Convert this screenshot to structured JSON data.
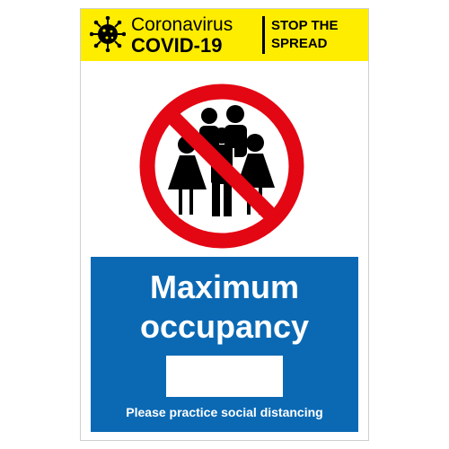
{
  "colors": {
    "header_bg": "#ffed00",
    "panel_bg": "#0b69b4",
    "prohibition_red": "#e30613",
    "figure_black": "#000000"
  },
  "header": {
    "brand_line1": "Coronavirus",
    "brand_line2": "COVID-19",
    "slogan_line1": "STOP THE",
    "slogan_line2": "SPREAD",
    "icon": "virus-icon"
  },
  "symbol": {
    "icon": "no-crowd-prohibition-icon"
  },
  "panel": {
    "title_line1": "Maximum",
    "title_line2": "occupancy",
    "count_value": "",
    "footer": "Please practice social distancing"
  }
}
